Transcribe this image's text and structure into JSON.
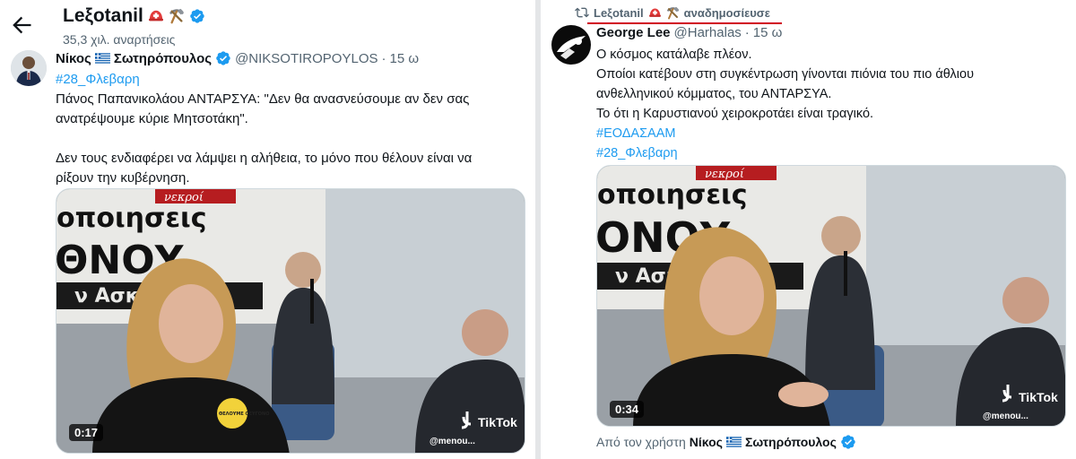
{
  "left": {
    "profile": {
      "name": "Leξotanil",
      "post_count": "35,3 χιλ. αναρτήσεις"
    },
    "tweet": {
      "author_name": "Νίκος",
      "author_name_suffix": "Σωτηρόπουλος",
      "handle": "@NIKSOTIROPOYLOS",
      "separator": "·",
      "time": "15 ω",
      "hashtag": "#28_Φλεβαρη",
      "text_lines": [
        "Πάνος Παπανικολάου ΑΝΤΑΡΣΥΑ: \"Δεν θα ανασνεύσουμε αν δεν σας",
        "ανατρέψουμε κύριε Μητσοτάκη\".",
        "",
        "Δεν τους ενδιαφέρει να λάμψει η αλήθεια, το μόνο που θέλουν είναι να",
        "ρίξουν την κυβέρνηση."
      ],
      "video": {
        "duration": "0:17",
        "watermark": "TikTok",
        "watermark_handle": "@menou..."
      },
      "banner_text": [
        "οποιησεις",
        "ΘΝΟΥ",
        "ν Ασκλ"
      ],
      "banner_red": "νεκροί",
      "badge_text": "ΘΕΛΟΥΜΕ ΟΞΥΓΟΝΟ"
    }
  },
  "right": {
    "repost": {
      "name": "Leξotanil",
      "label": "αναδημοσίευσε"
    },
    "tweet": {
      "author_name": "George Lee",
      "handle": "@Harhalas",
      "separator": "·",
      "time": "15 ω",
      "text_lines": [
        "Ο κόσμος κατάλαβε πλέον.",
        "Οποίοι κατέβουν στη συγκέντρωση γίνονται πιόνια του πιο άθλιου",
        "ανθελληνικού κόμματος, του ΑΝΤΑΡΣΥΑ.",
        "Το ότι η Καρυστιανού χειροκροτάει είναι τραγικό."
      ],
      "hashtags": [
        "#ΕΟΔΑΣΑΑΜ",
        "#28_Φλεβαρη"
      ],
      "video": {
        "duration": "0:34",
        "watermark": "TikTok",
        "watermark_handle": "@menou..."
      },
      "banner_text": [
        "οποιησεις",
        "ΟΝΟΥ",
        "ν Ασκλ"
      ],
      "banner_red": "νεκροί",
      "source_prefix": "Από τον χρήστη",
      "source_name": "Νίκος",
      "source_name_suffix": "Σωτηρόπουλος"
    }
  },
  "colors": {
    "accent": "#1d9bf0",
    "text": "#0f1419",
    "muted": "#536471",
    "underline": "#d1001f"
  },
  "icons": [
    "back-arrow-icon",
    "helmet-emoji-icon",
    "pickaxe-emoji-icon",
    "verified-badge-icon",
    "greek-flag-icon",
    "retweet-icon"
  ]
}
